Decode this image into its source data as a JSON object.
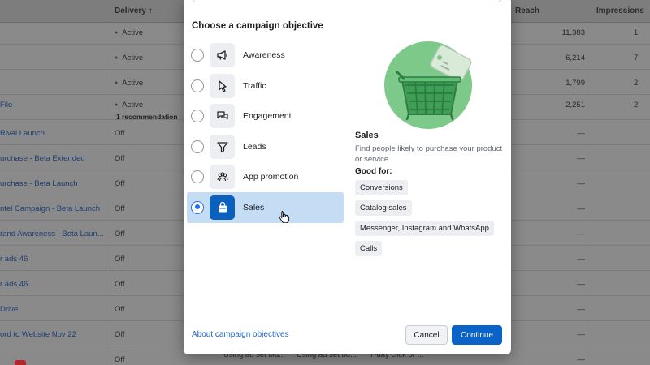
{
  "background_table": {
    "headers": {
      "delivery": "Delivery ↑",
      "reach": "Reach",
      "impressions": "Impressions"
    },
    "rows": [
      {
        "name": "",
        "delivery": "Active",
        "reach": "11,383",
        "impr": "1!"
      },
      {
        "name": "",
        "delivery": "Active",
        "reach": "6,214",
        "impr": "7"
      },
      {
        "name": "",
        "delivery": "Active",
        "reach": "1,799",
        "impr": "2"
      },
      {
        "name": "File",
        "delivery": "Active",
        "recommendation": "1 recommendation",
        "reach": "2,251",
        "impr": "2"
      },
      {
        "name": "Rival Launch",
        "delivery": "Off",
        "reach": "—",
        "impr": ""
      },
      {
        "name": "urchase - Beta Extended",
        "delivery": "Off",
        "reach": "—",
        "impr": ""
      },
      {
        "name": "urchase - Beta Launch",
        "delivery": "Off",
        "reach": "—",
        "impr": ""
      },
      {
        "name": "ntel Campaign - Beta Launch",
        "delivery": "Off",
        "reach": "—",
        "impr": ""
      },
      {
        "name": "rand Awareness - Beta Laun...",
        "delivery": "Off",
        "reach": "—",
        "impr": ""
      },
      {
        "name": "r ads 46",
        "delivery": "Off",
        "reach": "—",
        "impr": ""
      },
      {
        "name": "r ads 46",
        "delivery": "Off",
        "reach": "—",
        "impr": ""
      },
      {
        "name": "Drive",
        "delivery": "Off",
        "reach": "—",
        "impr": ""
      },
      {
        "name": "ord to Website Nov 22",
        "delivery": "Off",
        "reach": "—",
        "impr": ""
      },
      {
        "name": "",
        "delivery": "Off",
        "reach": "—",
        "impr": ""
      }
    ],
    "footer": [
      "Using ad set bid...",
      "Using ad set bu...",
      "7-day click or ..."
    ]
  },
  "dialog": {
    "title": "Choose a campaign objective",
    "options": [
      {
        "label": "Awareness",
        "icon": "megaphone-icon",
        "selected": false
      },
      {
        "label": "Traffic",
        "icon": "cursor-icon",
        "selected": false
      },
      {
        "label": "Engagement",
        "icon": "chat-bubbles-icon",
        "selected": false
      },
      {
        "label": "Leads",
        "icon": "funnel-icon",
        "selected": false
      },
      {
        "label": "App promotion",
        "icon": "people-icon",
        "selected": false
      },
      {
        "label": "Sales",
        "icon": "shopping-bag-icon",
        "selected": true
      }
    ],
    "detail": {
      "title": "Sales",
      "description": "Find people likely to purchase your product or service.",
      "good_for_label": "Good for:",
      "chips": [
        "Conversions",
        "Catalog sales",
        "Messenger, Instagram and WhatsApp",
        "Calls"
      ]
    },
    "about_link": "About campaign objectives",
    "cancel_label": "Cancel",
    "continue_label": "Continue"
  },
  "colors": {
    "accent": "#0a63c9",
    "selected_bg": "#c5dcf5",
    "illustration_green": "#7cc98a"
  }
}
